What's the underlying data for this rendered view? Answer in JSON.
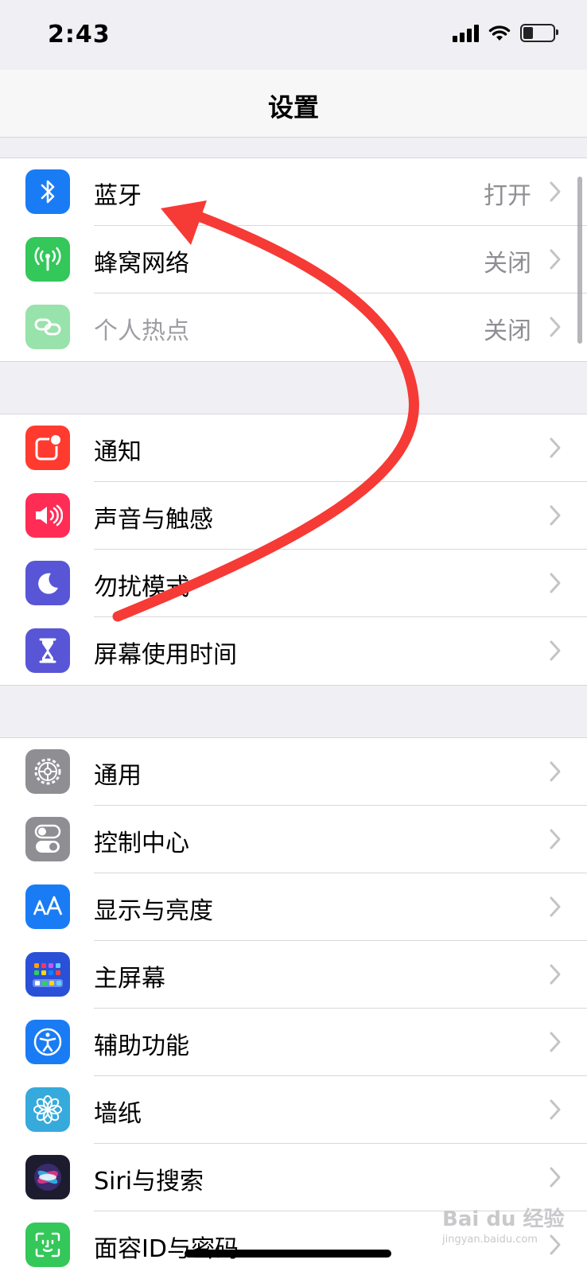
{
  "status_bar": {
    "time": "2:43"
  },
  "nav": {
    "title": "设置"
  },
  "section1": [
    {
      "label": "蓝牙",
      "value": "打开",
      "icon": "bluetooth-icon",
      "color": "#1a7cf5"
    },
    {
      "label": "蜂窝网络",
      "value": "关闭",
      "icon": "cellular-antenna-icon",
      "color": "#34c759"
    },
    {
      "label": "个人热点",
      "value": "关闭",
      "icon": "hotspot-link-icon",
      "color": "#34c759"
    }
  ],
  "section2": [
    {
      "label": "通知",
      "icon": "notifications-icon",
      "color": "#ff3b30"
    },
    {
      "label": "声音与触感",
      "icon": "speaker-icon",
      "color": "#ff2d55"
    },
    {
      "label": "勿扰模式",
      "icon": "moon-icon",
      "color": "#5856d6"
    },
    {
      "label": "屏幕使用时间",
      "icon": "hourglass-icon",
      "color": "#5856d6"
    }
  ],
  "section3": [
    {
      "label": "通用",
      "icon": "gear-icon",
      "color": "#8e8e93"
    },
    {
      "label": "控制中心",
      "icon": "toggle-switches-icon",
      "color": "#8e8e93"
    },
    {
      "label": "显示与亮度",
      "icon": "text-size-aa-icon",
      "color": "#1a7cf5"
    },
    {
      "label": "主屏幕",
      "icon": "home-screen-grid-icon",
      "color": "#2a50d8"
    },
    {
      "label": "辅助功能",
      "icon": "accessibility-icon",
      "color": "#1a7cf5"
    },
    {
      "label": "墙纸",
      "icon": "wallpaper-flower-icon",
      "color": "#36aadc"
    },
    {
      "label": "Siri与搜索",
      "icon": "siri-icon",
      "color": "#1c1c2e"
    },
    {
      "label": "面容ID与密码",
      "icon": "face-id-icon",
      "color": "#34c759"
    }
  ],
  "annotation": {
    "arrow_color": "#f63a35"
  },
  "watermark": {
    "brand": "Bai du 经验",
    "url": "jingyan.baidu.com"
  }
}
